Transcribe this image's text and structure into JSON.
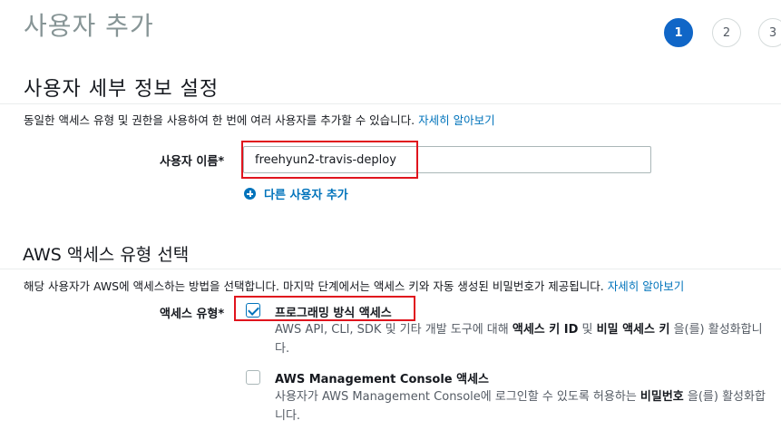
{
  "page": {
    "title": "사용자 추가"
  },
  "steps": [
    {
      "label": "1",
      "active": true
    },
    {
      "label": "2",
      "active": false
    },
    {
      "label": "3",
      "active": false
    }
  ],
  "user_details": {
    "section_title": "사용자 세부 정보 설정",
    "description": "동일한 액세스 유형 및 권한을 사용하여 한 번에 여러 사용자를 추가할 수 있습니다. ",
    "learn_more": "자세히 알아보기",
    "username_label": "사용자 이름*",
    "username_value": "freehyun2-travis-deploy",
    "add_another_user": "다른 사용자 추가"
  },
  "access_type": {
    "section_title": "AWS 액세스 유형 선택",
    "description": "해당 사용자가 AWS에 액세스하는 방법을 선택합니다. 마지막 단계에서는 액세스 키와 자동 생성된 비밀번호가 제공됩니다. ",
    "learn_more": "자세히 알아보기",
    "label": "액세스 유형*",
    "options": [
      {
        "title": "프로그래밍 방식 액세스",
        "checked": true,
        "desc_part1": "AWS API, CLI, SDK 및 기타 개발 도구에 대해 ",
        "desc_bold1": "액세스 키 ID",
        "desc_part2": " 및 ",
        "desc_bold2": "비밀 액세스 키",
        "desc_part3": " 을(를) 활성화합니다."
      },
      {
        "title": "AWS Management Console 액세스",
        "checked": false,
        "desc_part1": "사용자가 AWS Management Console에 로그인할 수 있도록 허용하는 ",
        "desc_bold1": "비밀번호",
        "desc_part2": " 을(를) 활성화합니다."
      }
    ]
  },
  "colors": {
    "accent": "#1066c7",
    "link": "#0073bb",
    "highlight": "#e0141d"
  }
}
